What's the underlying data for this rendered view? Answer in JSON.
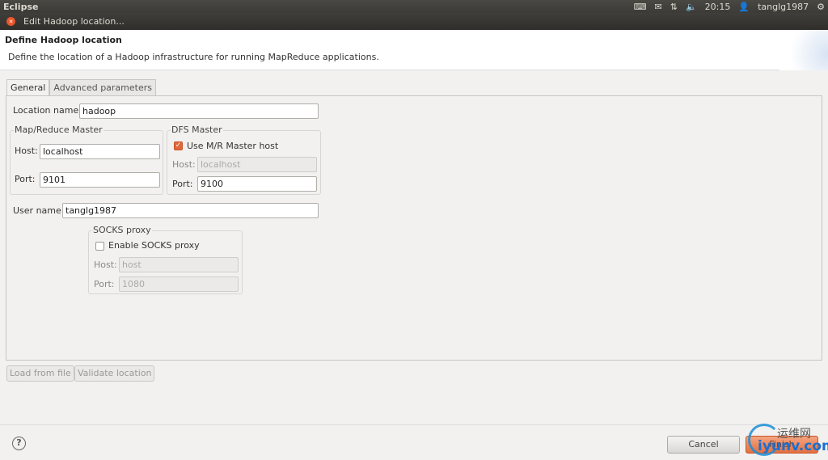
{
  "topbar": {
    "app": "Eclipse",
    "time": "20:15",
    "user": "tanglg1987"
  },
  "window": {
    "title": "Edit Hadoop location..."
  },
  "header": {
    "title": "Define Hadoop location",
    "description": "Define the location of a Hadoop infrastructure for running MapReduce applications."
  },
  "tabs": [
    {
      "label": "General"
    },
    {
      "label": "Advanced parameters"
    }
  ],
  "general": {
    "location_label": "Location name:",
    "location_value": "hadoop",
    "mr": {
      "title": "Map/Reduce Master",
      "host_label": "Host:",
      "host_value": "localhost",
      "port_label": "Port:",
      "port_value": "9101"
    },
    "dfs": {
      "title": "DFS Master",
      "use_mr_label": "Use M/R Master host",
      "use_mr_checked": true,
      "host_label": "Host:",
      "host_value": "localhost",
      "port_label": "Port:",
      "port_value": "9100"
    },
    "user_label": "User name:",
    "user_value": "tanglg1987",
    "socks": {
      "title": "SOCKS proxy",
      "enable_label": "Enable SOCKS proxy",
      "enabled": false,
      "host_label": "Host:",
      "host_value": "host",
      "port_label": "Port:",
      "port_value": "1080"
    }
  },
  "buttons": {
    "load": "Load from file",
    "validate": "Validate location",
    "help": "?",
    "cancel": "Cancel",
    "finish": "Finish"
  },
  "watermark": {
    "cn": "运维网",
    "en": "iyunv.com"
  }
}
